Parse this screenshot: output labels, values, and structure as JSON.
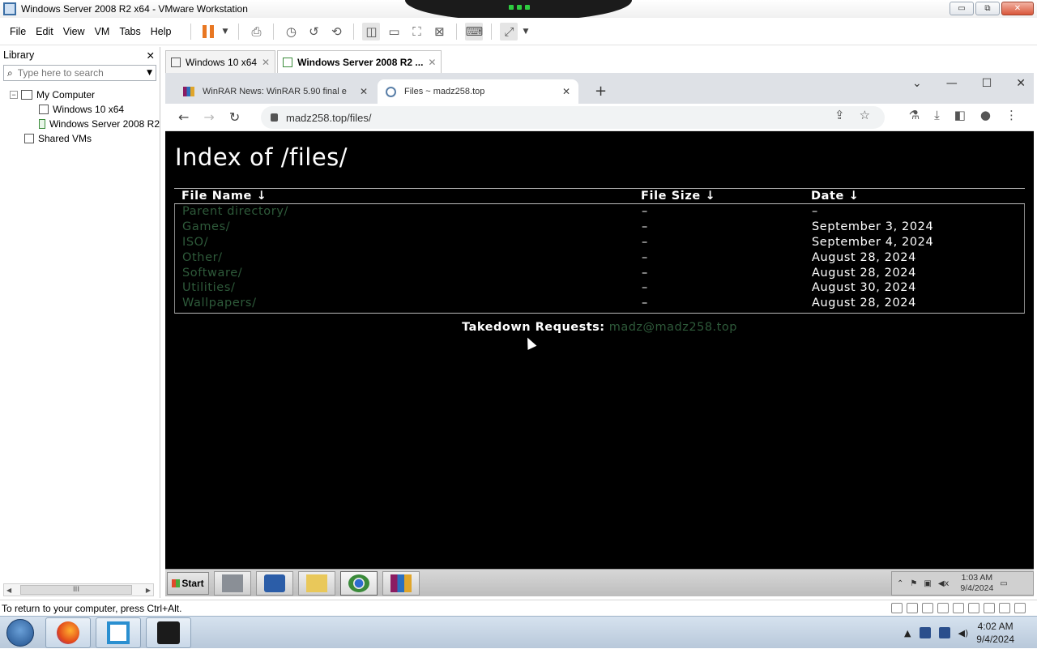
{
  "window": {
    "title": "Windows Server 2008 R2 x64 - VMware Workstation",
    "buttons": [
      "▭",
      "⧉",
      "✕"
    ]
  },
  "menubar": {
    "items": [
      "File",
      "Edit",
      "View",
      "VM",
      "Tabs",
      "Help"
    ]
  },
  "library": {
    "title": "Library",
    "close": "✕",
    "search_placeholder": "Type here to search",
    "tree": [
      {
        "label": "My Computer",
        "expander": "−"
      },
      {
        "label": "Windows 10 x64"
      },
      {
        "label": "Windows Server 2008 R2"
      },
      {
        "label": "Shared VMs"
      }
    ],
    "scroll_thumb": "III"
  },
  "vm_tabs": [
    {
      "label": "Windows 10 x64",
      "close": "✕"
    },
    {
      "label": "Windows Server 2008 R2 ...",
      "close": "✕"
    }
  ],
  "browser": {
    "tabs": [
      {
        "label": "WinRAR News: WinRAR 5.90 final e",
        "close": "✕"
      },
      {
        "label": "Files ~ madz258.top",
        "close": "✕"
      }
    ],
    "new_tab": "+",
    "window_buttons": [
      "⌄",
      "—",
      "☐",
      "✕"
    ],
    "nav": [
      "←",
      "→",
      "↻"
    ],
    "url": "madz258.top/files/",
    "page": {
      "heading": "Index of /files/",
      "headers": [
        "File Name  ↓",
        "File Size  ↓",
        "Date  ↓"
      ],
      "rows": [
        {
          "name": "Parent directory/",
          "size": "–",
          "date": "–"
        },
        {
          "name": "Games/",
          "size": "–",
          "date": "September 3, 2024"
        },
        {
          "name": "ISO/",
          "size": "–",
          "date": "September 4, 2024"
        },
        {
          "name": "Other/",
          "size": "–",
          "date": "August 28, 2024"
        },
        {
          "name": "Software/",
          "size": "–",
          "date": "August 28, 2024"
        },
        {
          "name": "Utilities/",
          "size": "–",
          "date": "August 30, 2024"
        },
        {
          "name": "Wallpapers/",
          "size": "–",
          "date": "August 28, 2024"
        }
      ],
      "footer_label": "Takedown Requests:",
      "footer_email": "madz@madz258.top"
    }
  },
  "guest_taskbar": {
    "start": "Start",
    "time": "1:03 AM",
    "date": "9/4/2024"
  },
  "status_bar": {
    "text": "To return to your computer, press Ctrl+Alt."
  },
  "host_taskbar": {
    "time": "4:02 AM",
    "date": "9/4/2024"
  },
  "colors": {
    "link": "#2e5a3a",
    "pause": "#e87722",
    "page_bg": "#000000"
  }
}
